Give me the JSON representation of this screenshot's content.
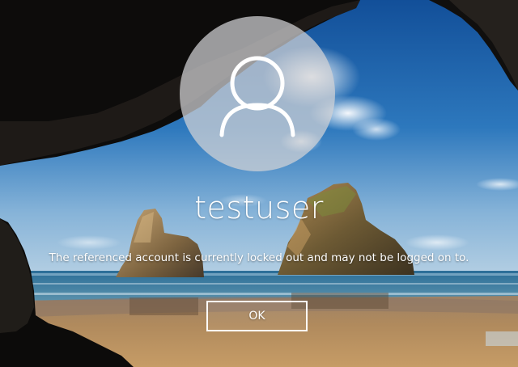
{
  "screen": {
    "type": "windows-lock-screen"
  },
  "user": {
    "avatar_icon": "user-icon",
    "username": "testuser"
  },
  "notice": {
    "message": "The referenced account is currently locked out and may not be logged on to."
  },
  "actions": {
    "ok_label": "OK"
  },
  "colors": {
    "text": "#ffffff",
    "sky_top": "#1b5fa8",
    "sea": "#2d6f96",
    "sand": "#b28b5e"
  }
}
